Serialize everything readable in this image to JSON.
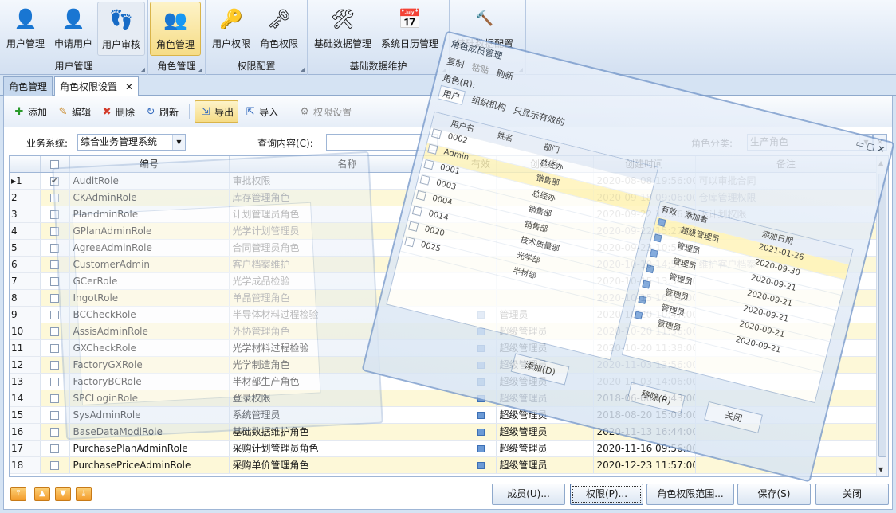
{
  "ribbon": {
    "groups": [
      {
        "title": "用户管理",
        "buttons": [
          {
            "label": "用户管理",
            "icon": "user-admin-icon"
          },
          {
            "label": "申请用户",
            "icon": "user-add-icon"
          },
          {
            "label": "用户审核",
            "icon": "footprint-icon"
          }
        ]
      },
      {
        "title": "角色管理",
        "buttons": [
          {
            "label": "角色管理",
            "icon": "group-users-icon"
          }
        ]
      },
      {
        "title": "权限配置",
        "buttons": [
          {
            "label": "用户权限",
            "icon": "user-key-icon"
          },
          {
            "label": "角色权限",
            "icon": "group-key-icon"
          }
        ]
      },
      {
        "title": "基础数据维护",
        "buttons": [
          {
            "label": "基础数据管理",
            "icon": "tools-icon"
          },
          {
            "label": "系统日历管理",
            "icon": "calendar-icon"
          }
        ]
      },
      {
        "title": "",
        "buttons": [
          {
            "label": "基础数据配置",
            "icon": "hammer-icon"
          }
        ]
      }
    ]
  },
  "tabs": [
    {
      "label": "角色管理"
    },
    {
      "label": "角色权限设置"
    }
  ],
  "toolbar": {
    "add": "添加",
    "edit": "编辑",
    "delete": "删除",
    "refresh": "刷新",
    "export": "导出",
    "import": "导入",
    "perm_settings": "权限设置"
  },
  "filters": {
    "system_label": "业务系统:",
    "system_value": "综合业务管理系统",
    "query_label": "查询内容(C):",
    "query_value": "",
    "category_label": "角色分类:",
    "category_value": "生产角色"
  },
  "grid": {
    "headers": [
      "编号",
      "名称",
      "有效",
      "创建者",
      "创建时间",
      "备注"
    ],
    "rows": [
      {
        "n": "1",
        "code": "AuditRole",
        "name": "审批权限",
        "valid": "",
        "creator": "",
        "time": "2020-08-08 19:56:00",
        "note": "可以审批合同"
      },
      {
        "n": "2",
        "code": "CKAdminRole",
        "name": "库存管理角色",
        "valid": "",
        "creator": "",
        "time": "2020-09-18 09:06:00",
        "note": "仓库管理权限"
      },
      {
        "n": "3",
        "code": "PlandminRole",
        "name": "计划管理员角色",
        "valid": "",
        "creator": "",
        "time": "2020-09-22 15:26:00",
        "note": "下计划权限"
      },
      {
        "n": "4",
        "code": "GPlanAdminRole",
        "name": "光学计划管理员",
        "valid": "",
        "creator": "",
        "time": "2020-09-22 15:27:00",
        "note": ""
      },
      {
        "n": "5",
        "code": "AgreeAdminRole",
        "name": "合同管理员角色",
        "valid": "",
        "creator": "",
        "time": "2020-09-23 10:53:00",
        "note": ""
      },
      {
        "n": "6",
        "code": "CustomerAdmin",
        "name": "客户档案维护",
        "valid": "",
        "creator": "",
        "time": "2020-10-10 14:56:00",
        "note": "维护客户档案"
      },
      {
        "n": "7",
        "code": "GCerRole",
        "name": "光学成品检验",
        "valid": "",
        "creator": "",
        "time": "2020-10-15 13:54:00",
        "note": ""
      },
      {
        "n": "8",
        "code": "IngotRole",
        "name": "单晶管理角色",
        "valid": "",
        "creator": "",
        "time": "2020-10-15 16:01:00",
        "note": ""
      },
      {
        "n": "9",
        "code": "BCCheckRole",
        "name": "半导体材料过程检验",
        "valid": "",
        "creator": "管理员",
        "time": "2020-10-20 10:47:00",
        "note": ""
      },
      {
        "n": "10",
        "code": "AssisAdminRole",
        "name": "外协管理角色",
        "valid": "",
        "creator": "超级管理员",
        "time": "2020-10-20 11:36:00",
        "note": ""
      },
      {
        "n": "11",
        "code": "GXCheckRole",
        "name": "光学材料过程检验",
        "valid": "",
        "creator": "超级管理员",
        "time": "2020-10-20 11:38:00",
        "note": ""
      },
      {
        "n": "12",
        "code": "FactoryGXRole",
        "name": "光学制造角色",
        "valid": "",
        "creator": "超级管理员",
        "time": "2020-11-03 13:56:00",
        "note": ""
      },
      {
        "n": "13",
        "code": "FactoryBCRole",
        "name": "半材部生产角色",
        "valid": "",
        "creator": "超级管理员",
        "time": "2020-11-03 14:06:00",
        "note": ""
      },
      {
        "n": "14",
        "code": "SPCLoginRole",
        "name": "登录权限",
        "valid": "",
        "creator": "超级管理员",
        "time": "2018-06-06 14:43:00",
        "note": ""
      },
      {
        "n": "15",
        "code": "SysAdminRole",
        "name": "系统管理员",
        "valid": "",
        "creator": "超级管理员",
        "time": "2018-08-20 15:09:00",
        "note": ""
      },
      {
        "n": "16",
        "code": "BaseDataModiRole",
        "name": "基础数据维护角色",
        "valid": "",
        "creator": "超级管理员",
        "time": "2020-11-13 16:44:00",
        "note": ""
      },
      {
        "n": "17",
        "code": "PurchasePlanAdminRole",
        "name": "采购计划管理员角色",
        "valid": "",
        "creator": "超级管理员",
        "time": "2020-11-16 09:56:00",
        "note": ""
      },
      {
        "n": "18",
        "code": "PurchasePriceAdminRole",
        "name": "采购单价管理角色",
        "valid": "",
        "creator": "超级管理员",
        "time": "2020-12-23 11:57:00",
        "note": ""
      }
    ]
  },
  "bottom": {
    "members": "成员(U)...",
    "perms": "权限(P)...",
    "scope": "角色权限范围...",
    "save": "保存(S)",
    "close": "关闭"
  },
  "overlay_dialog": {
    "title": "角色成员管理",
    "copy": "复制",
    "paste": "粘贴",
    "refresh": "刷新",
    "role_label": "角色(R):",
    "tab_user": "用户",
    "tab_org": "组织机构",
    "show_valid": "只显示有效的",
    "col_user": "用户名",
    "col_name": "姓名",
    "col_dept": "部门",
    "col_valid": "有效",
    "col_adder": "添加者",
    "col_date": "添加日期",
    "users": [
      {
        "id": "0002",
        "dept": "总经办"
      },
      {
        "id": "Admin",
        "dept": "销售部"
      },
      {
        "id": "0001",
        "dept": "总经办"
      },
      {
        "id": "0003",
        "dept": "销售部"
      },
      {
        "id": "0004",
        "dept": "销售部"
      },
      {
        "id": "0014",
        "dept": "技术质量部"
      },
      {
        "id": "0020",
        "dept": "光学部"
      },
      {
        "id": "0025",
        "dept": "半材部"
      }
    ],
    "members": [
      {
        "adder": "超级管理员",
        "date": "2021-01-26"
      },
      {
        "adder": "管理员",
        "date": "2020-09-30"
      },
      {
        "adder": "管理员",
        "date": "2020-09-21"
      },
      {
        "adder": "管理员",
        "date": "2020-09-21"
      },
      {
        "adder": "管理员",
        "date": "2020-09-21"
      },
      {
        "adder": "管理员",
        "date": "2020-09-21"
      },
      {
        "adder": "管理员",
        "date": "2020-09-21"
      }
    ],
    "add": "添加(D)",
    "remove": "移除(R)",
    "close": "关闭"
  }
}
